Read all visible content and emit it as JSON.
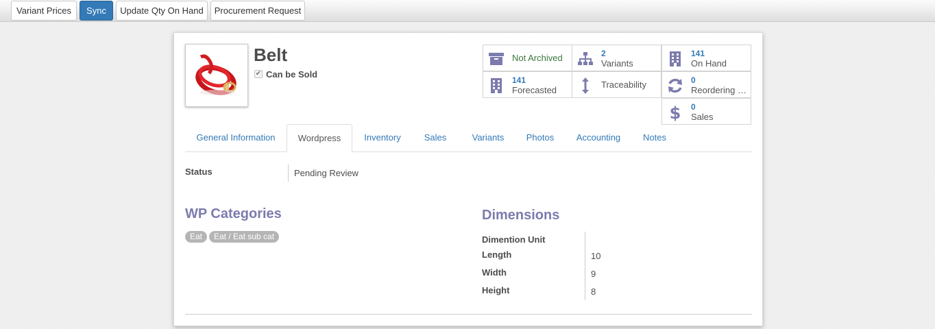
{
  "toolbar": {
    "buttons": [
      "Variant Prices",
      "Sync",
      "Update Qty On Hand",
      "Procurement Request"
    ]
  },
  "product": {
    "name": "Belt",
    "can_be_sold": "Can be Sold",
    "image": "belt-product-photo"
  },
  "stats": {
    "archived": {
      "label": "Not Archived",
      "icon": "archive-box-icon",
      "color": "#3c763d"
    },
    "variants": {
      "value": "2",
      "label": "Variants",
      "icon": "sitemap-icon"
    },
    "on_hand": {
      "value": "141",
      "label": "On Hand",
      "icon": "building-icon"
    },
    "forecasted": {
      "value": "141",
      "label": "Forecasted",
      "icon": "building-icon"
    },
    "traceability": {
      "label": "Traceability",
      "icon": "vertical-arrows-icon"
    },
    "reordering": {
      "value": "0",
      "label": "Reordering R...",
      "icon": "refresh-icon"
    },
    "sales": {
      "value": "0",
      "label": "Sales",
      "icon": "dollar-icon"
    }
  },
  "tabs": [
    "General Information",
    "Wordpress",
    "Inventory",
    "Sales",
    "Variants",
    "Photos",
    "Accounting",
    "Notes"
  ],
  "active_tab": "Wordpress",
  "status": {
    "label": "Status",
    "value": "Pending Review"
  },
  "wp_categories": {
    "title": "WP Categories",
    "tags": [
      "Eat",
      "Eat / Eat sub cat"
    ]
  },
  "dimensions": {
    "title": "Dimensions",
    "fields": [
      {
        "label": "Dimention Unit",
        "value": ""
      },
      {
        "label": "Length",
        "value": "10"
      },
      {
        "label": "Width",
        "value": "9"
      },
      {
        "label": "Height",
        "value": "8"
      }
    ]
  },
  "colors": {
    "primary": "#337ab7",
    "section_title": "#7c7bad",
    "stat_icon": "#7c7bad",
    "tag_bg": "#b5b5b5"
  }
}
